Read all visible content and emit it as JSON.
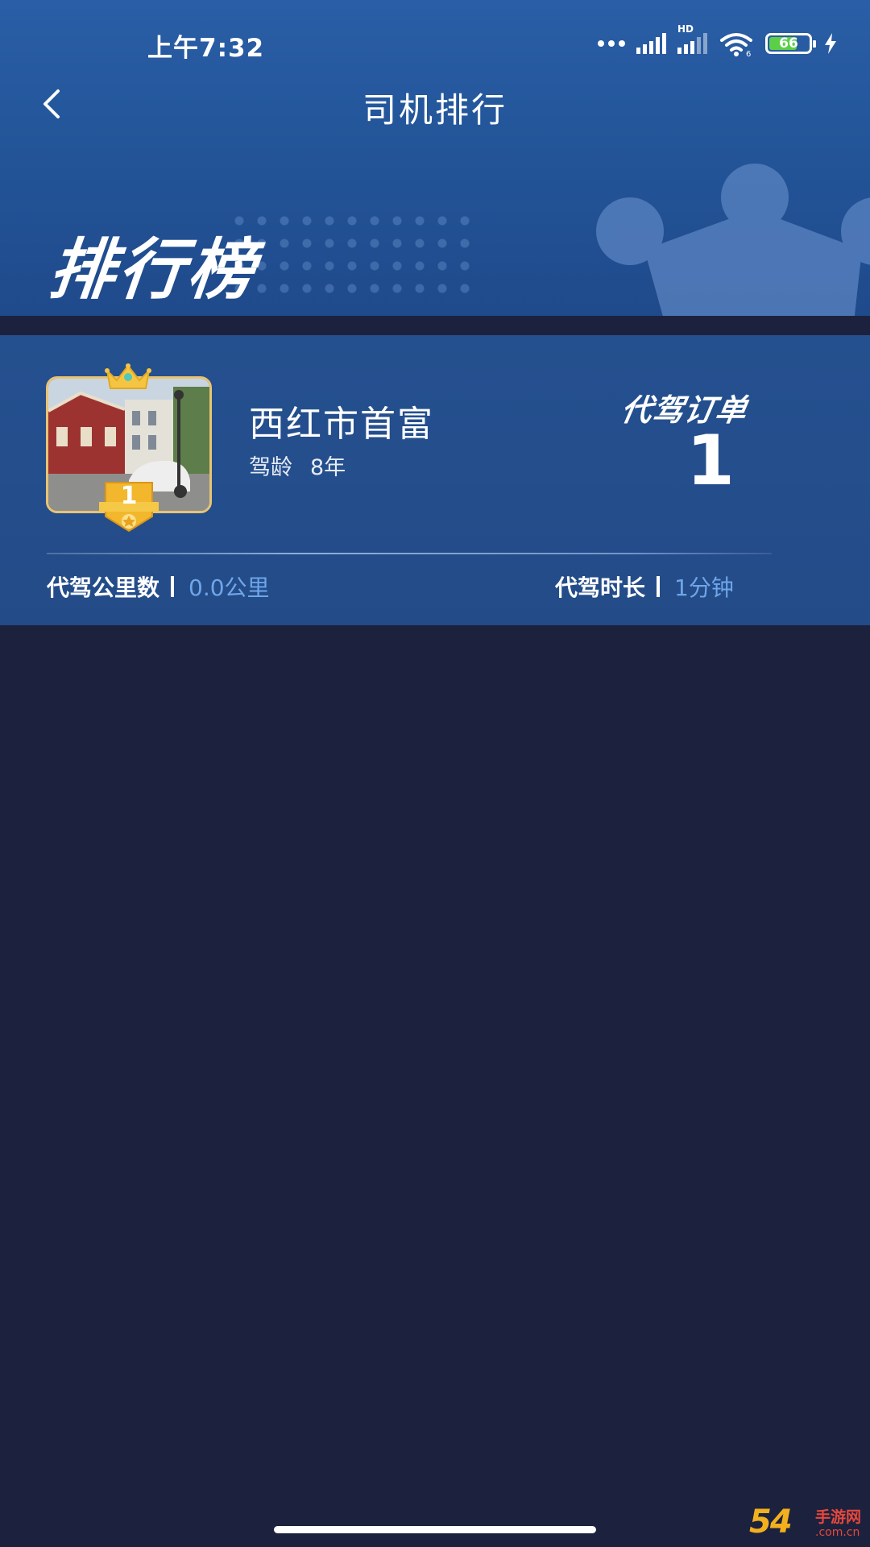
{
  "status_bar": {
    "time": "上午7:32",
    "network_label": "HD",
    "wifi_label": "6",
    "battery_level": "66"
  },
  "nav": {
    "title": "司机排行"
  },
  "banner": {
    "title": "排行榜"
  },
  "driver": {
    "rank": "1",
    "name": "西红市首富",
    "experience_label": "驾龄",
    "experience_value": "8年",
    "orders_label": "代驾订单",
    "orders_value": "1",
    "distance_label": "代驾公里数",
    "distance_value": "0.0公里",
    "duration_label": "代驾时长",
    "duration_value": "1分钟"
  },
  "watermark": {
    "number": "54",
    "name": "手游网",
    "url": ".com.cn"
  },
  "colors": {
    "header_blue": "#2a5ea6",
    "card_blue": "#25508f",
    "background": "#1c223e",
    "accent_value": "#6fa6ea",
    "gold": "#e8c472"
  }
}
